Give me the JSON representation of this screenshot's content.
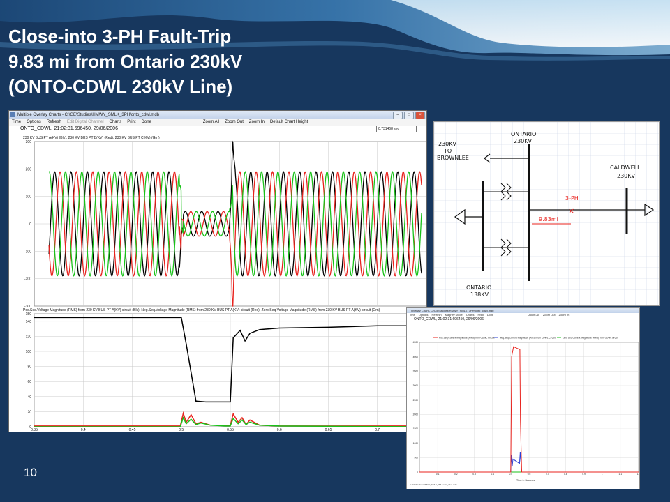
{
  "slide": {
    "title_lines": [
      "Close-into 3-PH Fault-Trip",
      "9.83 mi from Ontario 230kV",
      "(ONTO-CDWL 230kV Line)"
    ],
    "page_number": "10",
    "colors": {
      "background": "#17375e",
      "title": "#ffffff"
    }
  },
  "overlay_window": {
    "title": "Multiple Overlay Charts - C:\\GE\\Studies\\HMWY_SMLK_3PH\\onto_cdwl.mdb",
    "menu": [
      "Time",
      "Options",
      "Refresh",
      "Edit Digital Channel",
      "Charts",
      "Print",
      "Done",
      "Zoom All",
      "Zoom Out",
      "Zoom In",
      "Default Chart Height"
    ],
    "record": "ONTO_CDWL, 21:02:31.696450, 29/06/2006",
    "cursor_time": "0.731468 sec",
    "chart_top_legend": "230 KV BUS PT A(KV) (Blk), 230 KV BUS PT B(KV) (Red), 230 KV BUS PT C(KV) (Grn)",
    "chart_bottom_legend": "Pos.Seq.Voltage Magnitude (RMS) from 230 KV BUS PT A(KV) circuit (Blk), Neg.Seq.Voltage Magnitude (RMS) from 230 KV BUS PT A(KV) circuit (Red), Zero Seq.Voltage Magnitude (RMS) from 230 KV BUS PT A(KV) circuit (Grn)"
  },
  "diagram": {
    "labels": {
      "ontario_230": [
        "ONTARIO",
        "230KV"
      ],
      "brownlee": [
        "230KV",
        "TO",
        "BROWNLEE"
      ],
      "caldwell": [
        "CALDWELL",
        "230KV"
      ],
      "fault": "3-PH",
      "distance": "9.83mi",
      "ontario_138": [
        "ONTARIO",
        "138KV"
      ]
    }
  },
  "current_window": {
    "title": "Overlay Chart - C:\\GE\\Studies\\HMWY_SMLK_3PH\\onto_cdwl.mdb",
    "menu": [
      "Time",
      "Options",
      "Refresh",
      "Magnify Mode",
      "Charts",
      "Print",
      "Done",
      "Zoom All",
      "Zoom Out",
      "Zoom In"
    ],
    "record": "ONTO_CDWL, 21:02:31.696450, 29/06/2006",
    "legend": [
      "Pos.Seq.Current Magnitude (RMS) from CDWL Circuit",
      "Neg.Seq.Current Magnitude (RMS) from CDWL Circuit",
      "Zero Seq.Current Magnitude (RMS) from CDWL circuit"
    ],
    "footer": "C:\\GE\\Studies\\HMWY_SMLK_3PH\\onto_cdwl.mdb",
    "x_label": "Time in Seconds"
  },
  "chart_data": [
    {
      "type": "line",
      "legend_text": "230 KV BUS PT A(KV) (Blk), 230 KV BUS PT B(KV) (Red), 230 KV BUS PT C(KV) (Grn)",
      "y_ticks": [
        300,
        200,
        100,
        0,
        -100,
        -200,
        -300
      ],
      "ylim": [
        -300,
        300
      ],
      "xlim": [
        0.35,
        0.75
      ],
      "grid": true,
      "series": [
        {
          "name": "230 KV BUS PT A(KV) (Blk)",
          "color": "#000000",
          "amplitude": 190
        },
        {
          "name": "230 KV BUS PT B(KV) (Red)",
          "color": "#e8231e",
          "amplitude": 190
        },
        {
          "name": "230 KV BUS PT C(KV) (Grn)",
          "color": "#19c219",
          "amplitude": 190
        }
      ],
      "frequency_hz": 60,
      "fault_start": 0.5,
      "fault_end": 0.552,
      "fault_amplitude": 45
    },
    {
      "type": "line",
      "legend_text": "Pos.Seq.Voltage Magnitude (RMS) from 230 KV BUS PT A(KV) circuit (Blk), Neg.Seq.Voltage Magnitude (RMS) from 230 KV BUS PT A(KV) circuit (Red), Zero Seq.Voltage Magnitude (RMS) from 230 KV BUS PT A(KV) circuit (Grn)",
      "y_ticks": [
        150,
        140,
        120,
        100,
        80,
        60,
        40,
        20,
        0
      ],
      "ylim": [
        0,
        150
      ],
      "xlim": [
        0.35,
        0.75
      ],
      "x_ticks": [
        0.35,
        0.4,
        0.45,
        0.5,
        0.55,
        0.6,
        0.65,
        0.7
      ],
      "grid": true,
      "series": [
        {
          "name": "Pos.Seq (Blk)",
          "color": "#000000",
          "x": [
            0.35,
            0.5,
            0.505,
            0.515,
            0.525,
            0.55,
            0.553,
            0.56,
            0.565,
            0.57,
            0.58,
            0.6,
            0.65,
            0.7,
            0.75
          ],
          "y": [
            145,
            145,
            110,
            34,
            33,
            33,
            118,
            128,
            114,
            124,
            129,
            131,
            132,
            134,
            134
          ]
        },
        {
          "name": "Neg.Seq (Red)",
          "color": "#e8231e",
          "x": [
            0.35,
            0.499,
            0.502,
            0.505,
            0.51,
            0.515,
            0.52,
            0.53,
            0.545,
            0.55,
            0.553,
            0.558,
            0.562,
            0.566,
            0.57,
            0.58,
            0.6,
            0.75
          ],
          "y": [
            1,
            1,
            18,
            6,
            16,
            4,
            6,
            2,
            2,
            2,
            17,
            6,
            12,
            3,
            9,
            2,
            1,
            1
          ]
        },
        {
          "name": "Zero Seq (Grn)",
          "color": "#19c219",
          "x": [
            0.35,
            0.499,
            0.502,
            0.505,
            0.51,
            0.515,
            0.52,
            0.53,
            0.545,
            0.55,
            0.553,
            0.558,
            0.562,
            0.566,
            0.57,
            0.58,
            0.6,
            0.75
          ],
          "y": [
            0,
            0,
            12,
            4,
            10,
            3,
            5,
            2,
            1,
            1,
            11,
            4,
            9,
            3,
            6,
            2,
            1,
            0
          ]
        }
      ]
    },
    {
      "type": "line",
      "y_ticks": [
        4500,
        4000,
        3500,
        3000,
        2500,
        2000,
        1500,
        1000,
        500,
        0
      ],
      "ylim": [
        0,
        4500
      ],
      "x_ticks": [
        0.1,
        0.2,
        0.3,
        0.4,
        0.5,
        0.6,
        0.7,
        0.8,
        0.9,
        1.0,
        1.1,
        1.2
      ],
      "xlim": [
        0.0,
        1.2
      ],
      "xlabel": "Time in Seconds",
      "grid": true,
      "series": [
        {
          "name": "Pos.Seq.Current Magnitude (RMS) from CDWL Circuit",
          "color": "#e8231e",
          "x": [
            0.0,
            0.5,
            0.505,
            0.515,
            0.55,
            0.553,
            0.56,
            1.2
          ],
          "y": [
            0,
            0,
            4000,
            4350,
            4250,
            1800,
            0,
            0
          ]
        },
        {
          "name": "Neg.Seq.Current Magnitude (RMS) from CDWL Circuit",
          "color": "#2a3fd6",
          "x": [
            0.0,
            0.5,
            0.503,
            0.508,
            0.512,
            0.548,
            0.552,
            0.557,
            0.56,
            1.2
          ],
          "y": [
            0,
            0,
            600,
            200,
            450,
            300,
            700,
            250,
            0,
            0
          ]
        },
        {
          "name": "Zero Seq Current Magnitude (RMS) from CDWL circuit",
          "color": "#19c219",
          "x": [
            0.0,
            1.2
          ],
          "y": [
            0,
            0
          ]
        }
      ]
    }
  ]
}
